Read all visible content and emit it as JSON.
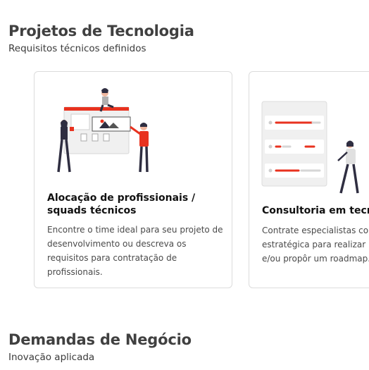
{
  "sections": [
    {
      "title": "Projetos de Tecnologia",
      "subtitle": "Requisitos técnicos definidos"
    },
    {
      "title": "Demandas de Negócio",
      "subtitle": "Inovação aplicada"
    }
  ],
  "cards": [
    {
      "title": "Alocação de profissionais / squads técnicos",
      "description": "Encontre o time ideal para seu projeto de desenvolvimento ou descreva os requisitos para contratação de profissionais.",
      "illustration": "team-presenting-board-illustration"
    },
    {
      "title": "Consultoria em tecnologia",
      "description": "Contrate especialistas com visão estratégica para realizar um diagnóstico e/ou propôr um roadmap.",
      "illustration": "person-with-checklist-illustration"
    }
  ],
  "colors": {
    "accent": "#e8321f",
    "heading": "#404040",
    "border": "#dcdcdc"
  }
}
